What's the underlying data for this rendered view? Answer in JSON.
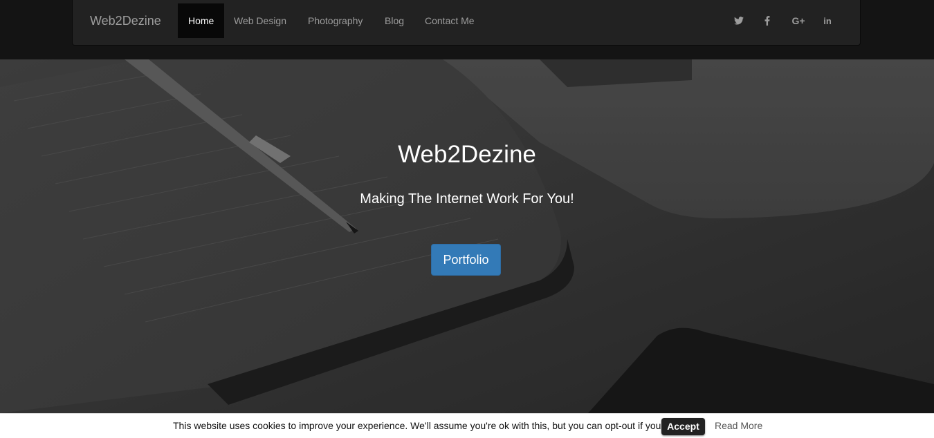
{
  "navbar": {
    "brand": "Web2Dezine",
    "items": [
      {
        "label": "Home",
        "active": true
      },
      {
        "label": "Web Design",
        "active": false
      },
      {
        "label": "Photography",
        "active": false
      },
      {
        "label": "Blog",
        "active": false
      },
      {
        "label": "Contact Me",
        "active": false
      }
    ],
    "social": [
      {
        "icon": "twitter-icon",
        "glyph": "t"
      },
      {
        "icon": "facebook-icon",
        "glyph": "f"
      },
      {
        "icon": "google-plus-icon",
        "glyph": "G+"
      },
      {
        "icon": "linkedin-icon",
        "glyph": "in"
      }
    ]
  },
  "hero": {
    "title": "Web2Dezine",
    "subtitle": "Making The Internet Work For You!",
    "button_label": "Portfolio"
  },
  "cookie": {
    "text": "This website uses cookies to improve your experience. We'll assume you're ok with this, but you can opt-out if you wish.",
    "accept_label": "Accept",
    "read_more_label": "Read More"
  },
  "colors": {
    "accent": "#337ab7",
    "navbar_bg": "#222222",
    "active_nav_bg": "#080808"
  }
}
